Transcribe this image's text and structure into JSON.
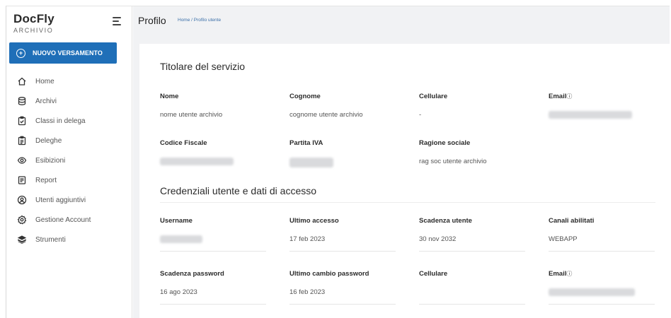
{
  "brand": {
    "name": "DocFly",
    "subtitle": "ARCHIVIO"
  },
  "sidebar": {
    "new_button": "NUOVO VERSAMENTO",
    "items": [
      {
        "label": "Home",
        "icon": "home-icon"
      },
      {
        "label": "Archivi",
        "icon": "database-icon"
      },
      {
        "label": "Classi in delega",
        "icon": "clipboard-check-icon"
      },
      {
        "label": "Deleghe",
        "icon": "clipboard-list-icon"
      },
      {
        "label": "Esibizioni",
        "icon": "eye-icon"
      },
      {
        "label": "Report",
        "icon": "report-icon"
      },
      {
        "label": "Utenti aggiuntivi",
        "icon": "user-circle-icon"
      },
      {
        "label": "Gestione Account",
        "icon": "gear-icon"
      },
      {
        "label": "Strumenti",
        "icon": "layers-icon"
      }
    ]
  },
  "header": {
    "title": "Profilo",
    "breadcrumb": "Home / Profilo utente"
  },
  "titolare": {
    "title": "Titolare del servizio",
    "nome_label": "Nome",
    "nome_value": "nome utente archivio",
    "cognome_label": "Cognome",
    "cognome_value": "cognome utente archivio",
    "cellulare_label": "Cellulare",
    "cellulare_value": "-",
    "email_label": "Email",
    "codice_fiscale_label": "Codice Fiscale",
    "partita_iva_label": "Partita IVA",
    "ragione_sociale_label": "Ragione sociale",
    "ragione_sociale_value": "rag soc utente archivio"
  },
  "credenziali": {
    "title": "Credenziali utente e dati di accesso",
    "username_label": "Username",
    "ultimo_accesso_label": "Ultimo accesso",
    "ultimo_accesso_value": "17 feb 2023",
    "scadenza_utente_label": "Scadenza utente",
    "scadenza_utente_value": "30 nov 2032",
    "canali_label": "Canali abilitati",
    "canali_value": "WEBAPP",
    "scadenza_password_label": "Scadenza password",
    "scadenza_password_value": "16 ago 2023",
    "ultimo_cambio_label": "Ultimo cambio password",
    "ultimo_cambio_value": "16 feb 2023",
    "cellulare_label": "Cellulare",
    "email_label": "Email"
  },
  "colors": {
    "primary": "#1f6fb8",
    "background": "#f1f2f4"
  }
}
